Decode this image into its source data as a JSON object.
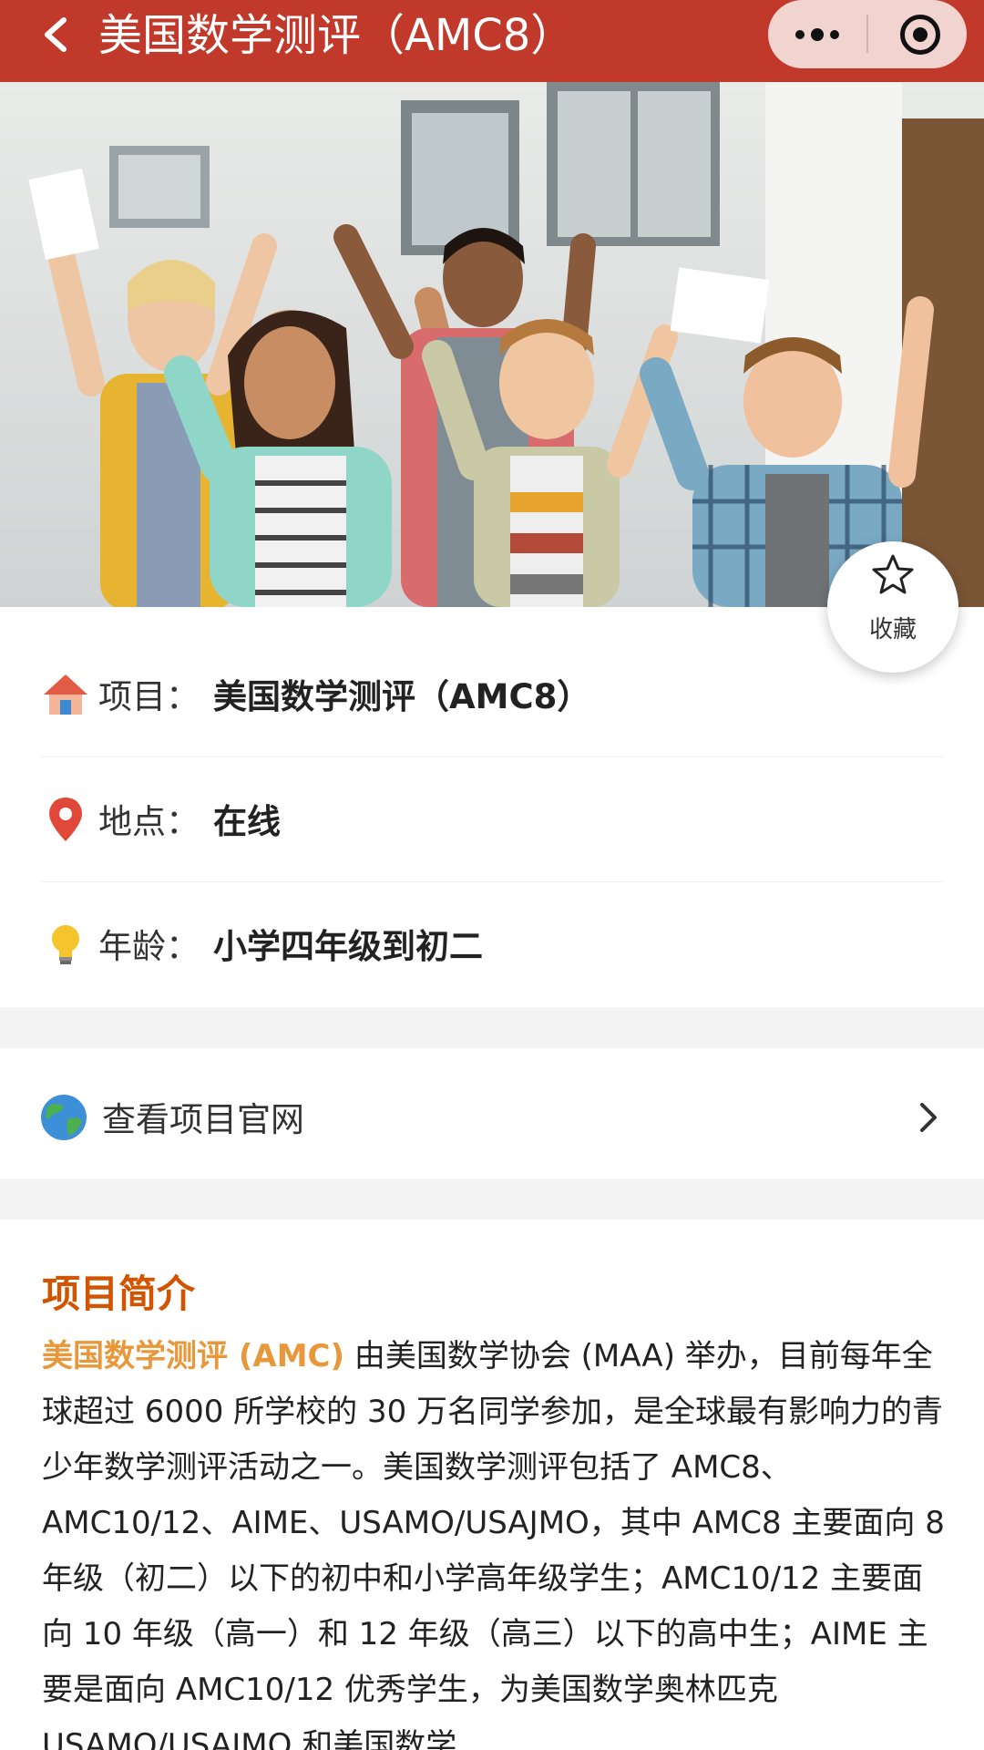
{
  "navbar": {
    "title": "美国数学测评（AMC8）",
    "back_icon": "chevron-left-icon",
    "more_icon": "more-dots-icon",
    "close_icon": "target-icon"
  },
  "hero": {
    "alt": "Group of cheering students holding papers"
  },
  "favorite": {
    "label": "收藏",
    "icon": "star-outline-icon"
  },
  "info": [
    {
      "icon": "house-icon",
      "label": "项目：",
      "value": "美国数学测评（AMC8）"
    },
    {
      "icon": "location-pin-icon",
      "label": "地点：",
      "value": "在线"
    },
    {
      "icon": "lightbulb-icon",
      "label": "年龄：",
      "value": "小学四年级到初二"
    }
  ],
  "website_link": {
    "icon": "globe-icon",
    "label": "查看项目官网"
  },
  "intro": {
    "title": "项目简介",
    "highlight": "美国数学测评 (AMC)",
    "body": " 由美国数学协会 (MAA) 举办，目前每年全球超过 6000 所学校的 30 万名同学参加，是全球最有影响力的青少年数学测评活动之一。美国数学测评包括了 AMC8、AMC10/12、AIME、USAMO/USAJMO，其中 AMC8 主要面向 8 年级（初二）以下的初中和小学高年级学生；AMC10/12 主要面向 10 年级（高一）和 12 年级（高三）以下的高中生；AIME 主要是面向 AMC10/12 优秀学生，为美国数学奥林匹克 USAMO/USAJMO 和美国数学"
  },
  "colors": {
    "navbar": "#c0392b",
    "section_title": "#d35400",
    "highlight": "#e8983a"
  }
}
